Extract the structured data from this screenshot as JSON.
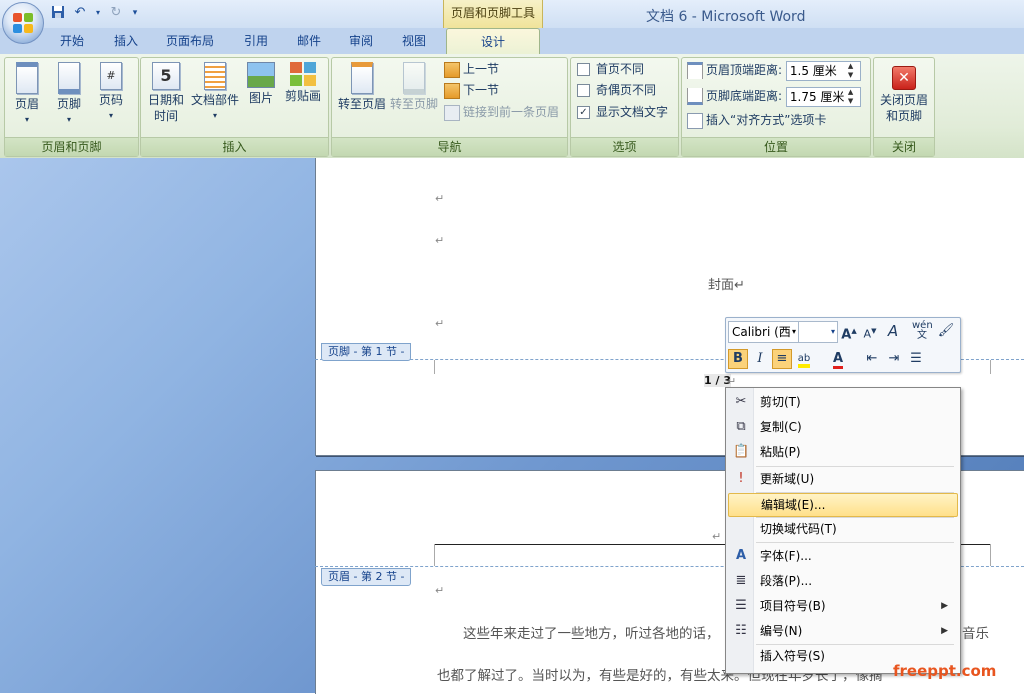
{
  "window": {
    "title": "文档 6 - Microsoft Word",
    "contextual_tab_group": "页眉和页脚工具"
  },
  "tabs": [
    "开始",
    "插入",
    "页面布局",
    "引用",
    "邮件",
    "审阅",
    "视图"
  ],
  "active_tab": "设计",
  "ribbon": {
    "group_header_footer": {
      "label": "页眉和页脚",
      "header": "页眉",
      "footer": "页脚",
      "page_number": "页码"
    },
    "group_insert": {
      "label": "插入",
      "date_time_1": "日期和",
      "date_time_2": "时间",
      "quick_parts": "文档部件",
      "picture": "图片",
      "clip_art": "剪贴画"
    },
    "group_navigation": {
      "label": "导航",
      "goto_header": "转至页眉",
      "goto_footer": "转至页脚",
      "previous": "上一节",
      "next": "下一节",
      "link_previous": "链接到前一条页眉"
    },
    "group_options": {
      "label": "选项",
      "different_first": "首页不同",
      "different_odd_even": "奇偶页不同",
      "show_doc_text": "显示文档文字"
    },
    "group_position": {
      "label": "位置",
      "header_from_top_label": "页眉顶端距离:",
      "header_from_top_value": "1.5 厘米",
      "footer_from_bottom_label": "页脚底端距离:",
      "footer_from_bottom_value": "1.75 厘米",
      "insert_alignment_tab": "插入“对齐方式”选项卡"
    },
    "group_close": {
      "label": "关闭",
      "close_1": "关闭页眉",
      "close_2": "和页脚"
    }
  },
  "document": {
    "cover_text": "封面↵",
    "para_mark": "↵",
    "footer_tab": "页脚 - 第 1 节 -",
    "header_tab": "页眉 - 第 2 节 -",
    "page_field": "1 / 3",
    "line1": "这些年来走过了一些地方，听过各地的话，",
    "line1_tail": "音乐",
    "line2": "也都了解过了。当时以为，有些是好的，有些太来。但现在年岁长了，像摘"
  },
  "mini_toolbar": {
    "font": "Calibri (西"
  },
  "context_menu": [
    {
      "label": "剪切(T)",
      "icon": "scissors-icon"
    },
    {
      "label": "复制(C)",
      "icon": "copy-icon"
    },
    {
      "label": "粘贴(P)",
      "icon": "paste-icon"
    },
    {
      "label": "更新域(U)",
      "icon": "update-field-icon"
    },
    {
      "label": "编辑域(E)...",
      "icon": ""
    },
    {
      "label": "切换域代码(T)",
      "icon": ""
    },
    {
      "label": "字体(F)...",
      "icon": "font-icon"
    },
    {
      "label": "段落(P)...",
      "icon": "paragraph-icon"
    },
    {
      "label": "项目符号(B)",
      "icon": "bullets-icon"
    },
    {
      "label": "编号(N)",
      "icon": "numbering-icon"
    },
    {
      "label": "插入符号(S)",
      "icon": ""
    }
  ],
  "watermark": "freeppt.com"
}
